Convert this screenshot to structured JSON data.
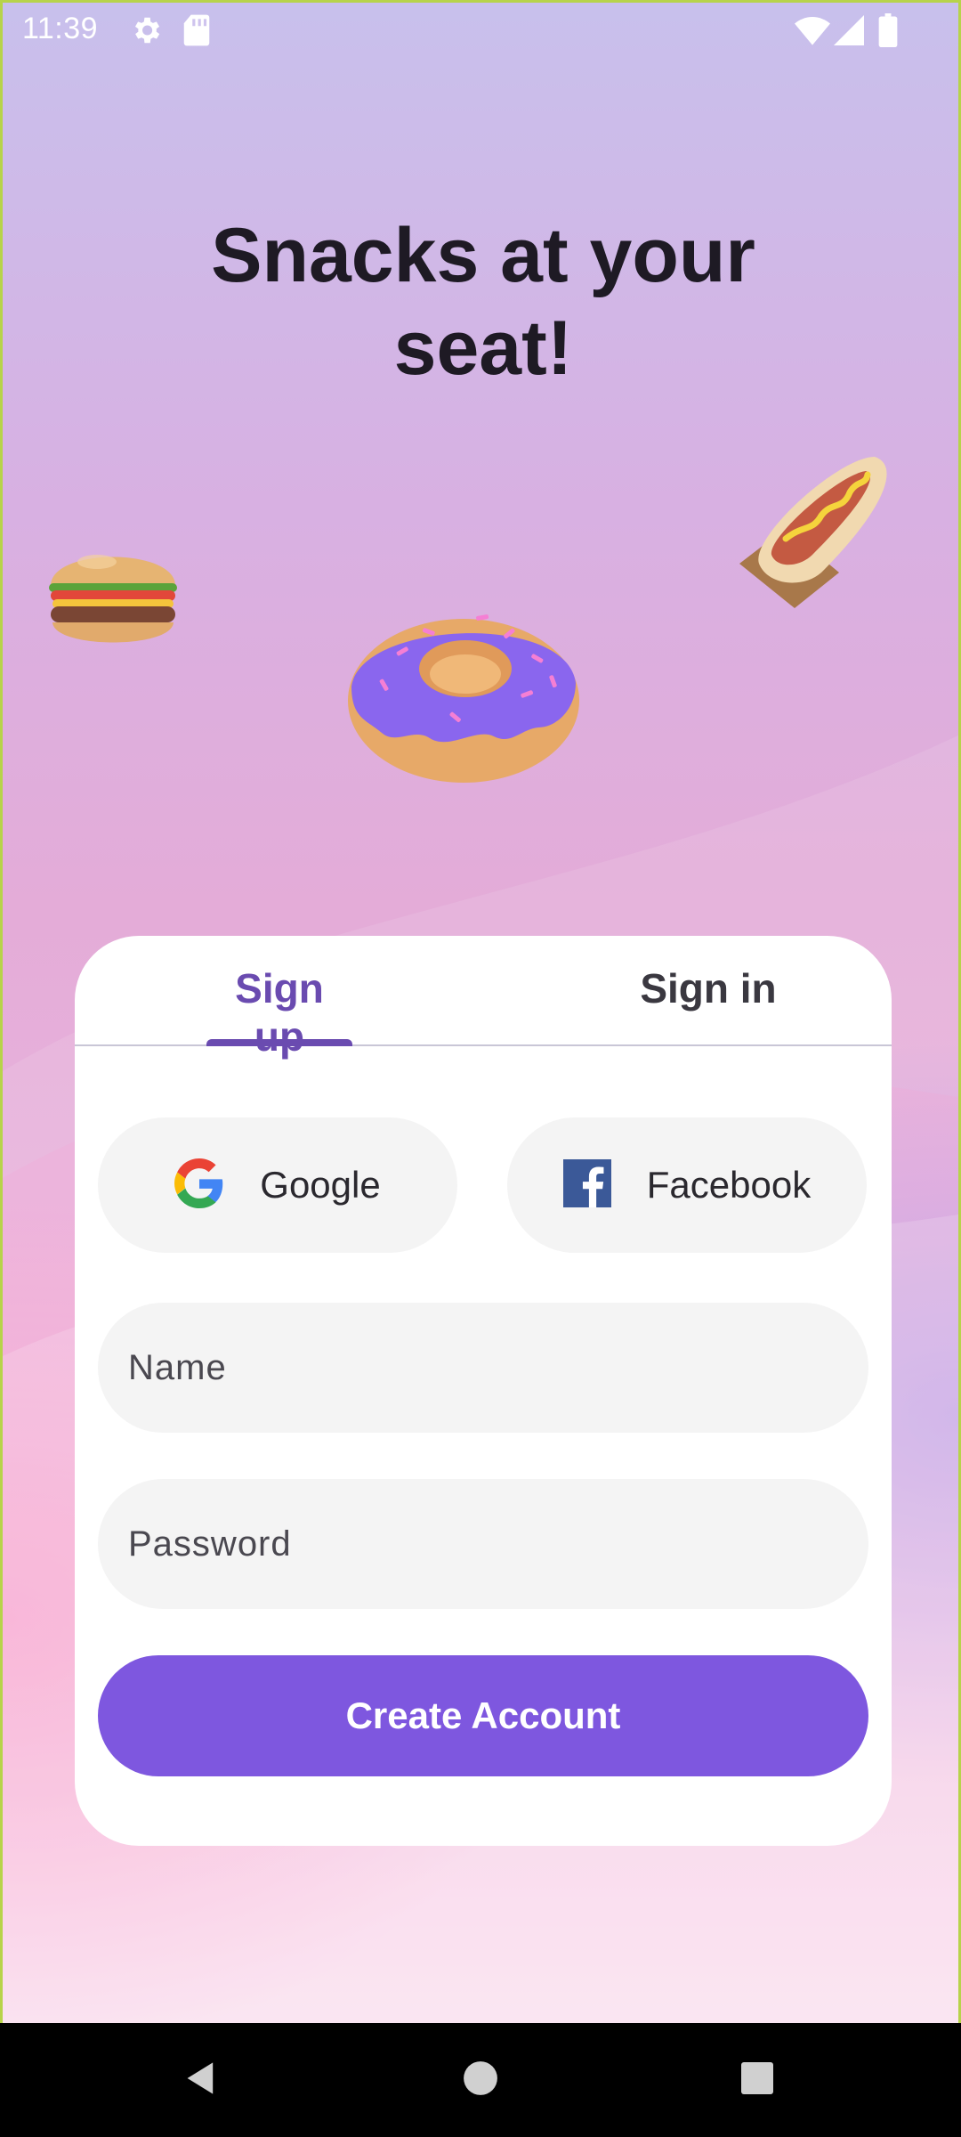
{
  "status_bar": {
    "time": "11:39",
    "left_icons": [
      "settings-icon",
      "sd-card-icon"
    ],
    "right_icons": [
      "wifi-icon",
      "cell-signal-icon",
      "battery-icon"
    ]
  },
  "hero": {
    "title_line1": "Snacks at your",
    "title_line2": "seat!",
    "illustrations": [
      "burger-illustration",
      "donut-illustration",
      "hotdog-illustration"
    ]
  },
  "auth_card": {
    "tabs": [
      {
        "label": "Sign up",
        "selected": true
      },
      {
        "label": "Sign in",
        "selected": false
      }
    ],
    "social": {
      "google_label": "Google",
      "facebook_label": "Facebook"
    },
    "fields": {
      "name_placeholder": "Name",
      "name_value": "",
      "password_placeholder": "Password",
      "password_value": ""
    },
    "submit_label": "Create Account"
  },
  "nav_bar": {
    "buttons": [
      "back-icon",
      "home-icon",
      "recents-icon"
    ]
  },
  "colors": {
    "accent": "#7e57df",
    "tab_selected": "#6a4bb0",
    "field_bg": "#f4f4f4",
    "title": "#1e1a24"
  }
}
